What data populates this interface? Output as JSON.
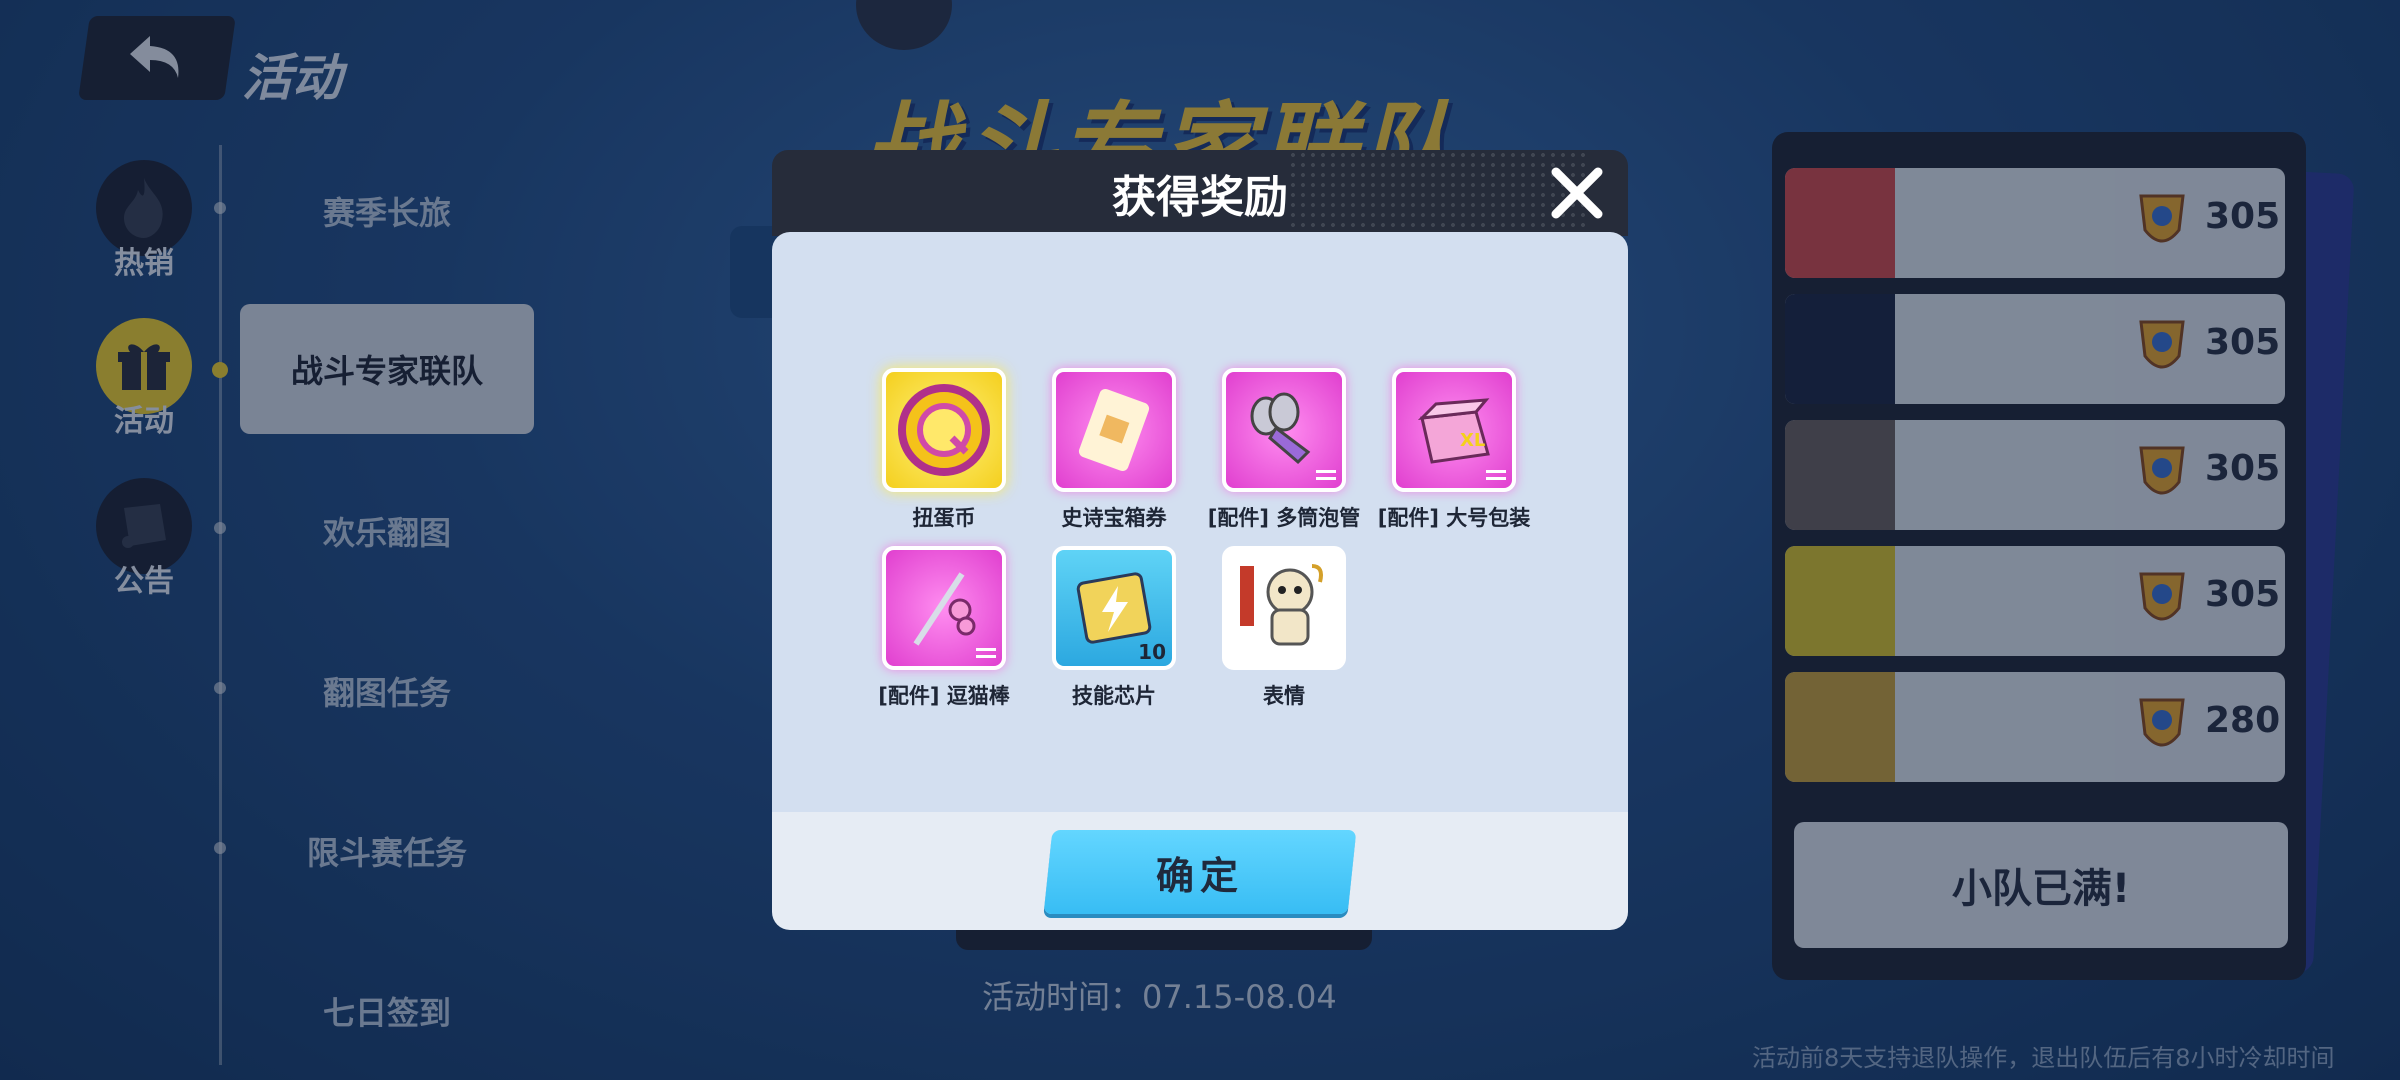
{
  "header": {
    "title": "活动",
    "back_icon": "back-arrow-icon"
  },
  "sidebar": {
    "icons": [
      {
        "label": "热销",
        "icon": "flame-icon"
      },
      {
        "label": "活动",
        "icon": "gift-icon",
        "active": true
      },
      {
        "label": "公告",
        "icon": "scroll-icon"
      }
    ],
    "items": [
      {
        "label": "赛季长旅"
      },
      {
        "label": "战斗专家联队",
        "active": true
      },
      {
        "label": "欢乐翻图"
      },
      {
        "label": "翻图任务"
      },
      {
        "label": "限斗赛任务"
      },
      {
        "label": "七日签到"
      }
    ]
  },
  "main": {
    "banner_title": "战斗专家联队",
    "activity_time": "活动时间：07.15-08.04"
  },
  "team_panel": {
    "rows": [
      {
        "score": "305",
        "color": "#d24a4a"
      },
      {
        "score": "305",
        "color": "#1c2540"
      },
      {
        "score": "305",
        "color": "#6b5f5c"
      },
      {
        "score": "305",
        "color": "#d9c32a"
      },
      {
        "score": "280",
        "color": "#c9a13a"
      }
    ],
    "full_label": "小队已满!",
    "notice": "活动前8天支持退队操作，退出队伍后有8小时冷却时间"
  },
  "modal": {
    "title": "获得奖励",
    "confirm_label": "确定",
    "rewards": [
      {
        "name": "扭蛋币",
        "tile": "gold",
        "icon": "gacha-coin-icon"
      },
      {
        "name": "史诗宝箱券",
        "tile": "purple",
        "icon": "chest-ticket-icon"
      },
      {
        "name": "[配件] 多筒泡管",
        "tile": "purple",
        "icon": "bubble-tube-icon"
      },
      {
        "name": "[配件] 大号包装",
        "tile": "purple",
        "icon": "big-package-icon"
      },
      {
        "name": "[配件] 逗猫棒",
        "tile": "purple",
        "icon": "cat-teaser-icon"
      },
      {
        "name": "技能芯片",
        "tile": "blue",
        "icon": "skill-chip-icon",
        "qty": "10"
      },
      {
        "name": "表情",
        "tile": "white",
        "icon": "mummy-emote-icon"
      }
    ]
  },
  "colors": {
    "accent": "#f2d22c",
    "confirm": "#4ccaf8",
    "modal_body": "#d3dff0"
  }
}
